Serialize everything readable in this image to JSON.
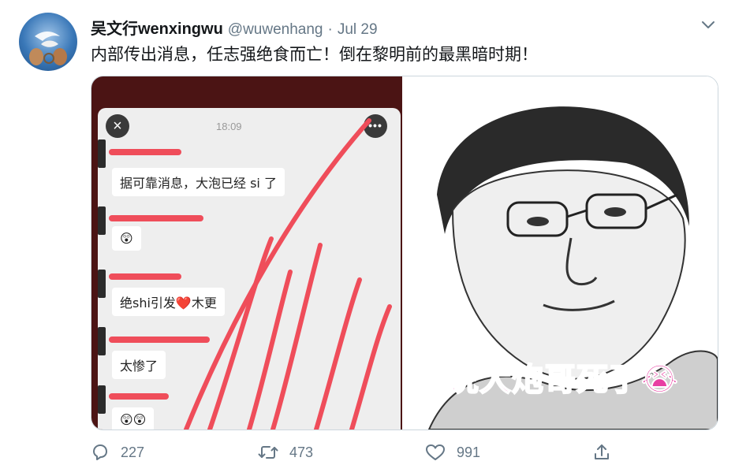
{
  "tweet": {
    "display_name": "吴文行wenxingwu",
    "handle": "@wuwenhang",
    "separator": "·",
    "date": "Jul 29",
    "text": "内部传出消息，任志强绝食而亡！倒在黎明前的最黑暗时期！"
  },
  "media": {
    "left": {
      "time": "18:09",
      "messages": [
        "据可靠消息，大泡已经 si 了",
        "😲",
        "绝shi引发❤️木更",
        "太惨了",
        "😲😲"
      ]
    },
    "right": {
      "caption": "听说大炮哥死了😭"
    }
  },
  "actions": {
    "reply_count": "227",
    "retweet_count": "473",
    "like_count": "991"
  },
  "colors": {
    "accent_red": "#ef4d5a",
    "caption_pink": "#e83fa3",
    "secondary_text": "#657786"
  },
  "icons": {
    "caret": "chevron-down-icon",
    "reply": "reply-icon",
    "retweet": "retweet-icon",
    "like": "heart-icon",
    "share": "share-icon"
  }
}
